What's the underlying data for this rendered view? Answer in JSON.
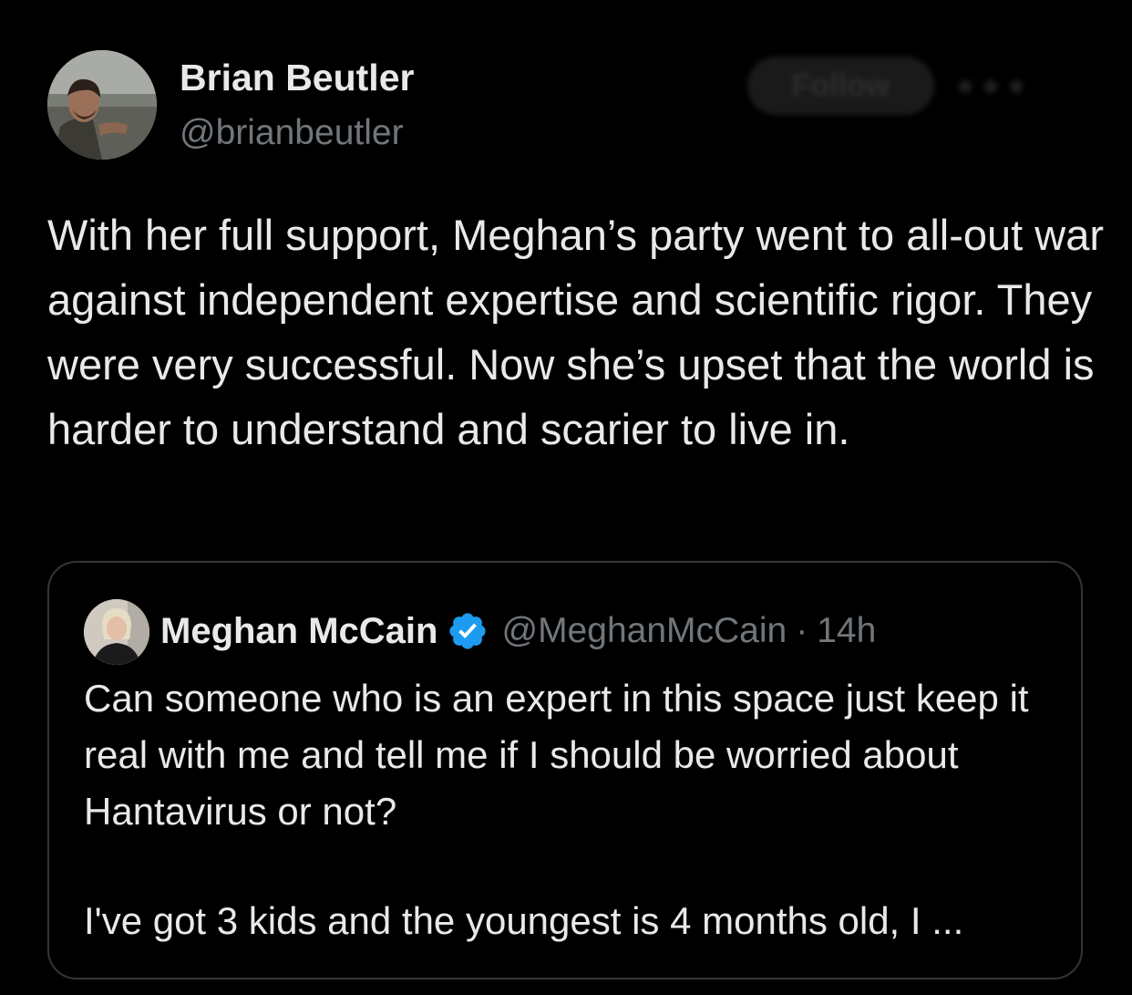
{
  "author": {
    "name": "Brian Beutler",
    "handle": "@brianbeutler"
  },
  "follow_button": {
    "label": "Follow"
  },
  "tweet": {
    "text": "With her full support, Meghan’s party went to all-out war against independent expertise and scientific rigor. They were very successful. Now she’s upset that the world is harder to understand and scarier to live in."
  },
  "quoted_tweet": {
    "name": "Meghan McCain",
    "handle": "@MeghanMcCain",
    "separator": "·",
    "time": "14h",
    "paragraphs": [
      "Can someone who is an expert in this space just keep it real with me and tell me if I should be worried about Hantavirus or not?",
      "I've got 3 kids and the youngest is 4 months old, I ..."
    ]
  },
  "colors": {
    "background": "#000000",
    "text_primary": "#e7e9ea",
    "text_secondary": "#71767b",
    "border": "#333639",
    "verified_blue": "#1d9bf0"
  },
  "icons": {
    "verified": "verified-badge-icon",
    "more": "more-options-icon"
  }
}
